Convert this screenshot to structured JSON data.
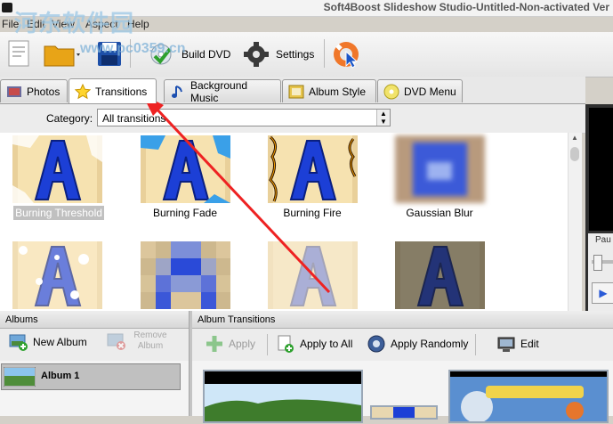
{
  "window": {
    "title": "Soft4Boost Slideshow Studio-Untitled-Non-activated Ver"
  },
  "watermark": {
    "text": "河东软件园",
    "url": "www.pc0359.cn"
  },
  "menu": [
    "File",
    "Edit",
    "View",
    "Aspect",
    "Help"
  ],
  "toolbar": {
    "build_dvd": "Build DVD",
    "settings": "Settings"
  },
  "tabs": [
    {
      "label": "Photos",
      "icon": "photos-icon"
    },
    {
      "label": "Transitions",
      "icon": "star-icon"
    },
    {
      "label": "Background Music",
      "icon": "music-note-icon"
    },
    {
      "label": "Album Style",
      "icon": "album-style-icon"
    },
    {
      "label": "DVD Menu",
      "icon": "dvd-menu-icon"
    }
  ],
  "active_tab": "Transitions",
  "category": {
    "label": "Category:",
    "value": "All transitions"
  },
  "transitions": [
    "Burning Threshold",
    "Burning Fade",
    "Burning Fire",
    "Gaussian Blur"
  ],
  "transitions_selected": "Burning Threshold",
  "right_panel": {
    "label": "Pau"
  },
  "albums_panel": {
    "title": "Albums",
    "new_album": "New Album",
    "remove_album": "Remove Album",
    "items": [
      "Album 1"
    ]
  },
  "album_transitions_panel": {
    "title": "Album Transitions",
    "apply": "Apply",
    "apply_to_all": "Apply to All",
    "apply_randomly": "Apply Randomly",
    "edit": "Edit"
  },
  "colors": {
    "selection": "#c0c0c0",
    "annotation_arrow": "#ee2222",
    "thumb_blue": "#1c3fd6"
  }
}
